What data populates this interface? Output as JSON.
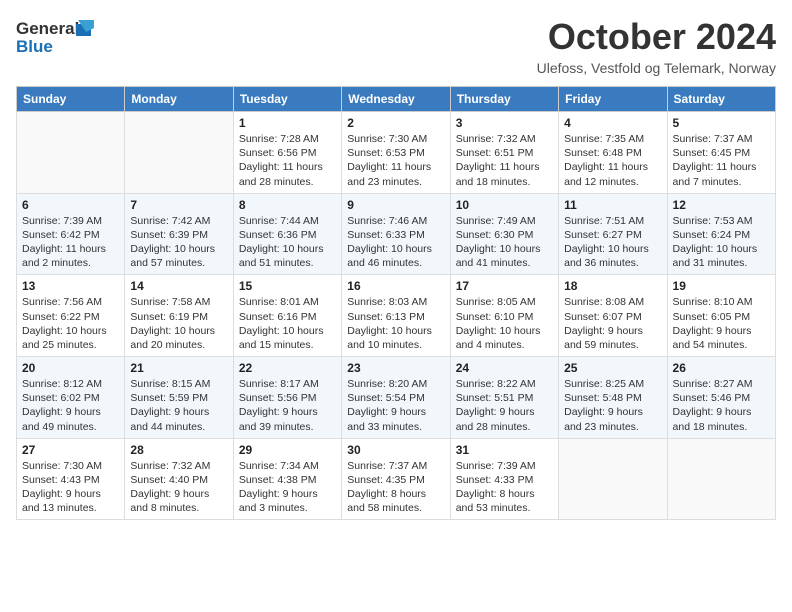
{
  "header": {
    "logo_line1": "General",
    "logo_line2": "Blue",
    "month_title": "October 2024",
    "subtitle": "Ulefoss, Vestfold og Telemark, Norway"
  },
  "weekdays": [
    "Sunday",
    "Monday",
    "Tuesday",
    "Wednesday",
    "Thursday",
    "Friday",
    "Saturday"
  ],
  "weeks": [
    [
      {
        "day": "",
        "info": ""
      },
      {
        "day": "",
        "info": ""
      },
      {
        "day": "1",
        "info": "Sunrise: 7:28 AM\nSunset: 6:56 PM\nDaylight: 11 hours and 28 minutes."
      },
      {
        "day": "2",
        "info": "Sunrise: 7:30 AM\nSunset: 6:53 PM\nDaylight: 11 hours and 23 minutes."
      },
      {
        "day": "3",
        "info": "Sunrise: 7:32 AM\nSunset: 6:51 PM\nDaylight: 11 hours and 18 minutes."
      },
      {
        "day": "4",
        "info": "Sunrise: 7:35 AM\nSunset: 6:48 PM\nDaylight: 11 hours and 12 minutes."
      },
      {
        "day": "5",
        "info": "Sunrise: 7:37 AM\nSunset: 6:45 PM\nDaylight: 11 hours and 7 minutes."
      }
    ],
    [
      {
        "day": "6",
        "info": "Sunrise: 7:39 AM\nSunset: 6:42 PM\nDaylight: 11 hours and 2 minutes."
      },
      {
        "day": "7",
        "info": "Sunrise: 7:42 AM\nSunset: 6:39 PM\nDaylight: 10 hours and 57 minutes."
      },
      {
        "day": "8",
        "info": "Sunrise: 7:44 AM\nSunset: 6:36 PM\nDaylight: 10 hours and 51 minutes."
      },
      {
        "day": "9",
        "info": "Sunrise: 7:46 AM\nSunset: 6:33 PM\nDaylight: 10 hours and 46 minutes."
      },
      {
        "day": "10",
        "info": "Sunrise: 7:49 AM\nSunset: 6:30 PM\nDaylight: 10 hours and 41 minutes."
      },
      {
        "day": "11",
        "info": "Sunrise: 7:51 AM\nSunset: 6:27 PM\nDaylight: 10 hours and 36 minutes."
      },
      {
        "day": "12",
        "info": "Sunrise: 7:53 AM\nSunset: 6:24 PM\nDaylight: 10 hours and 31 minutes."
      }
    ],
    [
      {
        "day": "13",
        "info": "Sunrise: 7:56 AM\nSunset: 6:22 PM\nDaylight: 10 hours and 25 minutes."
      },
      {
        "day": "14",
        "info": "Sunrise: 7:58 AM\nSunset: 6:19 PM\nDaylight: 10 hours and 20 minutes."
      },
      {
        "day": "15",
        "info": "Sunrise: 8:01 AM\nSunset: 6:16 PM\nDaylight: 10 hours and 15 minutes."
      },
      {
        "day": "16",
        "info": "Sunrise: 8:03 AM\nSunset: 6:13 PM\nDaylight: 10 hours and 10 minutes."
      },
      {
        "day": "17",
        "info": "Sunrise: 8:05 AM\nSunset: 6:10 PM\nDaylight: 10 hours and 4 minutes."
      },
      {
        "day": "18",
        "info": "Sunrise: 8:08 AM\nSunset: 6:07 PM\nDaylight: 9 hours and 59 minutes."
      },
      {
        "day": "19",
        "info": "Sunrise: 8:10 AM\nSunset: 6:05 PM\nDaylight: 9 hours and 54 minutes."
      }
    ],
    [
      {
        "day": "20",
        "info": "Sunrise: 8:12 AM\nSunset: 6:02 PM\nDaylight: 9 hours and 49 minutes."
      },
      {
        "day": "21",
        "info": "Sunrise: 8:15 AM\nSunset: 5:59 PM\nDaylight: 9 hours and 44 minutes."
      },
      {
        "day": "22",
        "info": "Sunrise: 8:17 AM\nSunset: 5:56 PM\nDaylight: 9 hours and 39 minutes."
      },
      {
        "day": "23",
        "info": "Sunrise: 8:20 AM\nSunset: 5:54 PM\nDaylight: 9 hours and 33 minutes."
      },
      {
        "day": "24",
        "info": "Sunrise: 8:22 AM\nSunset: 5:51 PM\nDaylight: 9 hours and 28 minutes."
      },
      {
        "day": "25",
        "info": "Sunrise: 8:25 AM\nSunset: 5:48 PM\nDaylight: 9 hours and 23 minutes."
      },
      {
        "day": "26",
        "info": "Sunrise: 8:27 AM\nSunset: 5:46 PM\nDaylight: 9 hours and 18 minutes."
      }
    ],
    [
      {
        "day": "27",
        "info": "Sunrise: 7:30 AM\nSunset: 4:43 PM\nDaylight: 9 hours and 13 minutes."
      },
      {
        "day": "28",
        "info": "Sunrise: 7:32 AM\nSunset: 4:40 PM\nDaylight: 9 hours and 8 minutes."
      },
      {
        "day": "29",
        "info": "Sunrise: 7:34 AM\nSunset: 4:38 PM\nDaylight: 9 hours and 3 minutes."
      },
      {
        "day": "30",
        "info": "Sunrise: 7:37 AM\nSunset: 4:35 PM\nDaylight: 8 hours and 58 minutes."
      },
      {
        "day": "31",
        "info": "Sunrise: 7:39 AM\nSunset: 4:33 PM\nDaylight: 8 hours and 53 minutes."
      },
      {
        "day": "",
        "info": ""
      },
      {
        "day": "",
        "info": ""
      }
    ]
  ]
}
